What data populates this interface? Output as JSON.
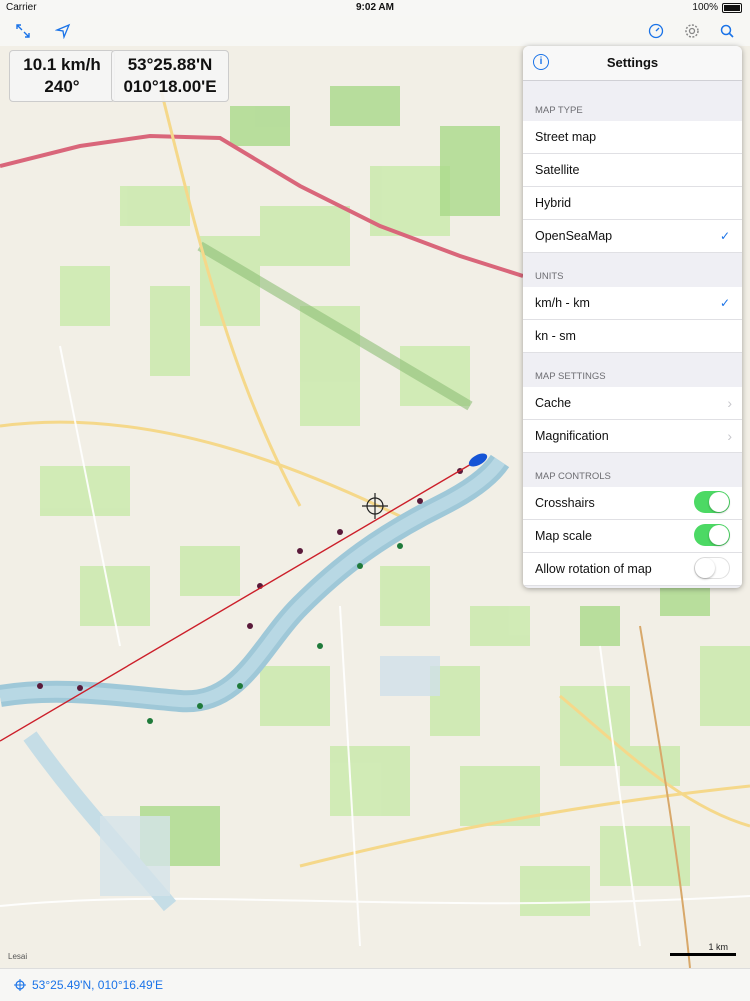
{
  "status_bar": {
    "carrier": "Carrier",
    "time": "9:02 AM",
    "battery": "100%"
  },
  "toolbar": {
    "expand_icon": "expand-icon",
    "locate_icon": "location-arrow-icon",
    "compass_icon": "compass-icon",
    "settings_icon": "gear-icon",
    "search_icon": "search-icon"
  },
  "speed_box": {
    "speed": "10.1 km/h",
    "heading": "240°"
  },
  "position_box": {
    "lat": "53°25.88'N",
    "lon": "010°18.00'E"
  },
  "settings": {
    "title": "Settings",
    "sections": [
      {
        "header": "MAP TYPE",
        "rows": [
          "Street map",
          "Satellite",
          "Hybrid",
          "OpenSeaMap"
        ],
        "checked": "OpenSeaMap"
      },
      {
        "header": "UNITS",
        "rows": [
          "km/h - km",
          "kn - sm"
        ],
        "checked": "km/h - km"
      },
      {
        "header": "MAP SETTINGS",
        "rows": [
          "Cache",
          "Magnification"
        ]
      },
      {
        "header": "MAP CONTROLS",
        "rows": [
          "Crosshairs",
          "Map scale",
          "Allow rotation of map"
        ]
      }
    ],
    "toggles": {
      "crosshairs": true,
      "map_scale": true,
      "allow_rotation": false
    },
    "check_mark": "✓",
    "chevron": "›"
  },
  "footer": {
    "cursor_coords": "53°25.49'N, 010°16.49'E"
  },
  "scale": {
    "label": "1 km"
  },
  "map_label": "Lesai"
}
